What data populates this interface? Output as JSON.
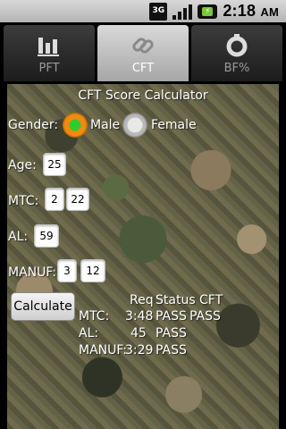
{
  "status_bar": {
    "network_label": "3G",
    "time": "2:18",
    "ampm": "AM"
  },
  "tabs": [
    {
      "label": "PFT",
      "icon": "bar-chart-icon",
      "selected": false
    },
    {
      "label": "CFT",
      "icon": "chain-link-icon",
      "selected": true
    },
    {
      "label": "BF%",
      "icon": "gear-icon",
      "selected": false
    }
  ],
  "calculator": {
    "title": "CFT Score Calculator",
    "gender_label": "Gender:",
    "gender_options": [
      "Male",
      "Female"
    ],
    "gender_selected": "Male",
    "age_label": "Age:",
    "age_value": "25",
    "mtc_label": "MTC:",
    "mtc_minutes": "2",
    "mtc_seconds": "22",
    "al_label": "AL:",
    "al_value": "59",
    "manuf_label": "MANUF:",
    "manuf_minutes": "3",
    "manuf_seconds": "12",
    "calculate_label": "Calculate"
  },
  "results": {
    "header_req": "Req",
    "header_status": "Status",
    "header_cft": "CFT",
    "rows": [
      {
        "label": "MTC:",
        "req": "3:48",
        "status": "PASS",
        "cft": "PASS"
      },
      {
        "label": "AL:",
        "req": "45",
        "status": "PASS"
      },
      {
        "label": "MANUF:",
        "req": "3:29",
        "status": "PASS"
      }
    ]
  }
}
